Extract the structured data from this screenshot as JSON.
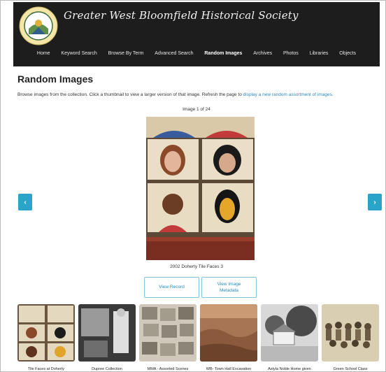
{
  "site": {
    "title": "Greater West Bloomfield Historical Society",
    "logo_ring_text": "GREATER WEST BLOOMFIELD HISTORICAL SOCIETY"
  },
  "nav": [
    {
      "label": "Home"
    },
    {
      "label": "Keyword Search"
    },
    {
      "label": "Browse By Term"
    },
    {
      "label": "Advanced Search"
    },
    {
      "label": "Random Images",
      "active": true
    },
    {
      "label": "Archives"
    },
    {
      "label": "Photos"
    },
    {
      "label": "Libraries"
    },
    {
      "label": "Objects"
    }
  ],
  "page": {
    "title": "Random Images",
    "intro_text": "Browse images from the collection. Click a thumbnail to view a larger version of that image. Refresh the page to",
    "intro_link": "display a new random assortment of images.",
    "counter": "Image 1 of 24",
    "caption": "2002 Doherty Tile Faces 3",
    "view_record": "View Record",
    "view_metadata_line1": "View Image",
    "view_metadata_line2": "Metadata",
    "prev_arrow": "‹",
    "next_arrow": "›"
  },
  "thumbnails": [
    {
      "label": "Tile Faces at Doherty"
    },
    {
      "label": "Dupree Collection"
    },
    {
      "label": "MMA - Assorted Scenes"
    },
    {
      "label": "WB- Town Hall Excavation"
    },
    {
      "label": "Astyla Noble Home given"
    },
    {
      "label": "Green School Class"
    }
  ],
  "colors": {
    "header_bg": "#1d1d1d",
    "accent": "#2aa4c8",
    "link": "#2a8ab8"
  }
}
